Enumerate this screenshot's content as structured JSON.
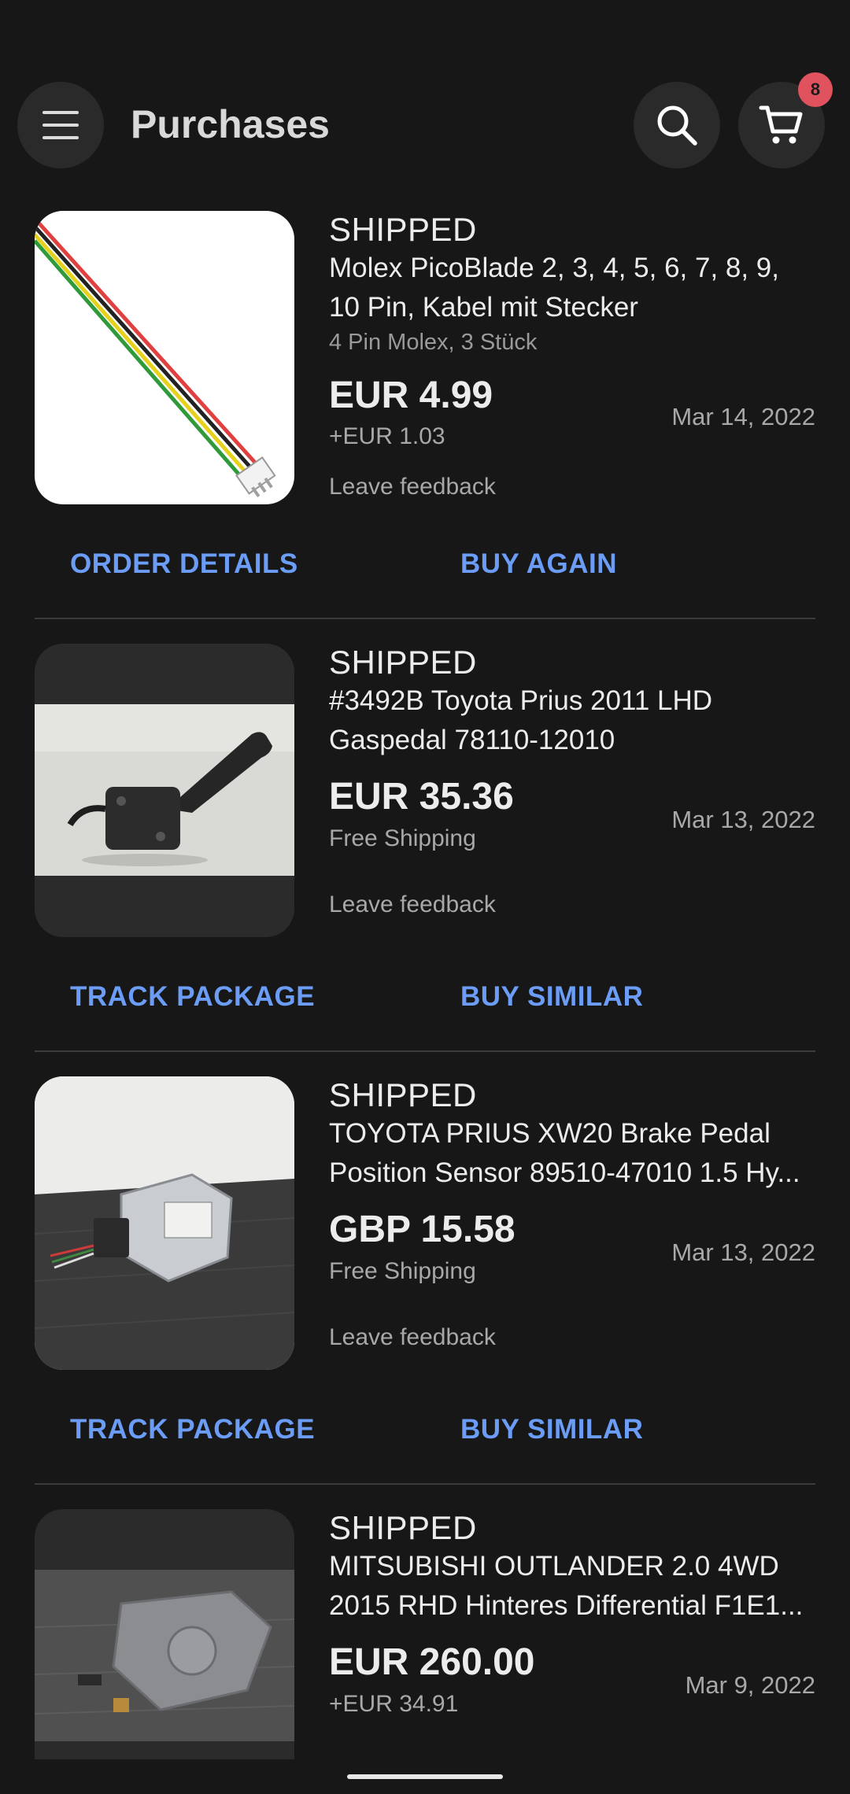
{
  "header": {
    "title": "Purchases",
    "menu_icon": "hamburger-menu-icon",
    "search_icon": "search-icon",
    "cart_icon": "cart-icon",
    "cart_badge": "8",
    "badge_color": "#e0535e"
  },
  "accent_color": "#6b9cf6",
  "orders": [
    {
      "status": "SHIPPED",
      "name_line1": "Molex PicoBlade 2, 3, 4, 5, 6, 7, 8, 9,",
      "name_line2": "10 Pin, Kabel mit Stecker",
      "variant": "4 Pin Molex, 3 Stück",
      "price": "EUR 4.99",
      "shipping": "+EUR 1.03",
      "date": "Mar 14, 2022",
      "feedback": "Leave feedback",
      "action1": "ORDER DETAILS",
      "action2": "BUY AGAIN"
    },
    {
      "status": "SHIPPED",
      "name_line1": "#3492B Toyota Prius 2011 LHD",
      "name_line2": "Gaspedal 78110-12010",
      "price": "EUR 35.36",
      "shipping": "Free Shipping",
      "date": "Mar 13, 2022",
      "feedback": "Leave feedback",
      "action1": "TRACK PACKAGE",
      "action2": "BUY SIMILAR"
    },
    {
      "status": "SHIPPED",
      "name_line1": "TOYOTA PRIUS XW20 Brake Pedal",
      "name_line2": "Position Sensor 89510-47010 1.5 Hy...",
      "price": "GBP 15.58",
      "shipping": "Free Shipping",
      "date": "Mar 13, 2022",
      "feedback": "Leave feedback",
      "action1": "TRACK PACKAGE",
      "action2": "BUY SIMILAR"
    },
    {
      "status": "SHIPPED",
      "name_line1": "MITSUBISHI OUTLANDER 2.0 4WD",
      "name_line2": "2015 RHD Hinteres Differential F1E1...",
      "price": "EUR 260.00",
      "shipping": "+EUR 34.91",
      "date": "Mar 9, 2022"
    }
  ]
}
